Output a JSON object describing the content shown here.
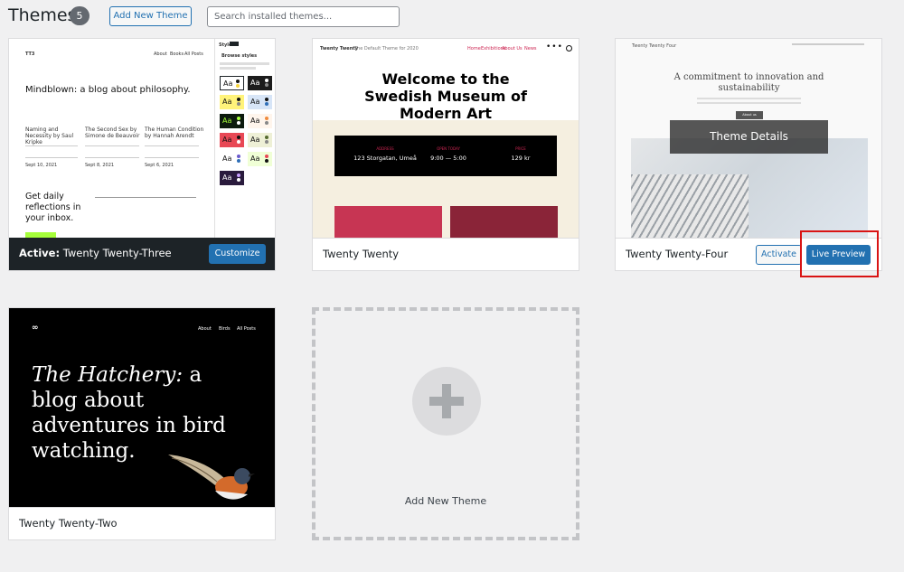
{
  "header": {
    "title": "Themes",
    "count": "5",
    "add_button": "Add New Theme",
    "search_placeholder": "Search installed themes..."
  },
  "themes": [
    {
      "name": "Twenty Twenty-Three",
      "active_label": "Active:",
      "button": "Customize",
      "screenshot": {
        "logo": "TT3",
        "nav": [
          "About",
          "Books",
          "All Posts"
        ],
        "headline": "Mindblown: a blog about philosophy.",
        "posts": [
          {
            "title": "Naming and Necessity by Saul Kripke",
            "date": "Sept 10, 2021"
          },
          {
            "title": "The Second Sex by Simone de Beauvoir",
            "date": "Sept 8, 2021"
          },
          {
            "title": "The Human Condition by Hannah Arendt",
            "date": "Sept 6, 2021"
          }
        ],
        "cta": "Get daily reflections in your inbox.",
        "panel_title": "Styles",
        "panel_sub": "Browse styles",
        "swatch_label": "Aa"
      }
    },
    {
      "name": "Twenty Twenty",
      "screenshot": {
        "logo": "Twenty Twenty",
        "tagline": "The Default Theme for 2020",
        "nav": [
          "Home",
          "Exhibitions",
          "About Us",
          "News"
        ],
        "headline": "Welcome to the Swedish Museum of Modern Art",
        "info": [
          {
            "label": "ADDRESS",
            "value": "123 Storgatan, Umeå"
          },
          {
            "label": "OPEN TODAY",
            "value": "9:00 — 5:00"
          },
          {
            "label": "PRICE",
            "value": "129 kr"
          }
        ]
      }
    },
    {
      "name": "Twenty Twenty-Four",
      "activate": "Activate",
      "preview": "Live Preview",
      "overlay": "Theme Details",
      "screenshot": {
        "logo": "Twenty Twenty Four",
        "headline": "A commitment to innovation and sustainability",
        "button": "About us"
      }
    },
    {
      "name": "Twenty Twenty-Two",
      "screenshot": {
        "nav": [
          "About",
          "Birds",
          "All Posts"
        ],
        "headline_italic": "The Hatchery:",
        "headline_rest": " a blog about adventures in bird watching."
      }
    }
  ],
  "add_new": {
    "label": "Add New Theme"
  },
  "colors": {
    "accent": "#2271b1",
    "highlight": "#d91414",
    "background": "#f0f0f1"
  }
}
